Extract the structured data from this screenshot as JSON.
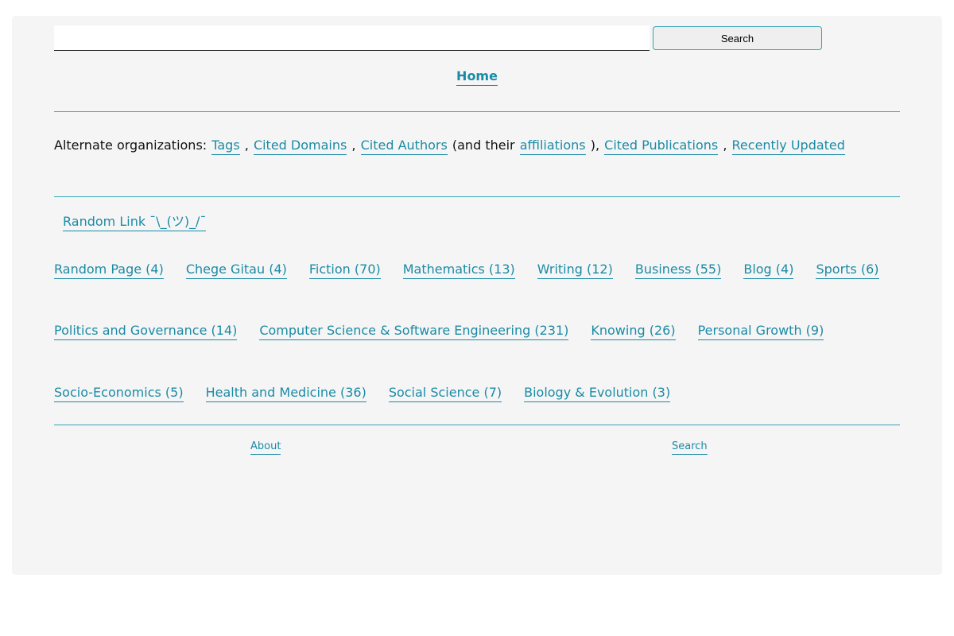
{
  "search": {
    "value": "",
    "placeholder": "",
    "button_label": "Search"
  },
  "nav": {
    "home_label": "Home"
  },
  "alternate": {
    "prefix": "Alternate organizations: ",
    "tags": "Tags",
    "sep1": " , ",
    "cited_domains": "Cited Domains",
    "sep2": " , ",
    "cited_authors": "Cited Authors",
    "and_their": " (and their ",
    "affiliations": "affiliations",
    "close_paren": " ), ",
    "cited_publications": "Cited Publications",
    "sep3": " , ",
    "recently_updated": "Recently Updated"
  },
  "random_link": "Random Link ¯\\_(ツ)_/¯",
  "categories": {
    "row1": [
      "Random Page (4)",
      "Chege Gitau (4)",
      "Fiction (70)",
      "Mathematics (13)",
      "Writing (12)",
      "Business (55)",
      "Blog (4)",
      "Sports (6)"
    ],
    "row2": [
      "Politics and Governance (14)",
      "Computer Science & Software Engineering (231)",
      "Knowing (26)",
      "Personal Growth (9)"
    ],
    "row3": [
      "Socio-Economics (5)",
      "Health and Medicine (36)",
      "Social Science (7)",
      "Biology & Evolution (3)"
    ]
  },
  "footer": {
    "about": "About",
    "search": "Search"
  },
  "colors": {
    "link": "#1a8ba6",
    "rule": "#34a4b4",
    "panel_bg": "#f5f5f5"
  }
}
